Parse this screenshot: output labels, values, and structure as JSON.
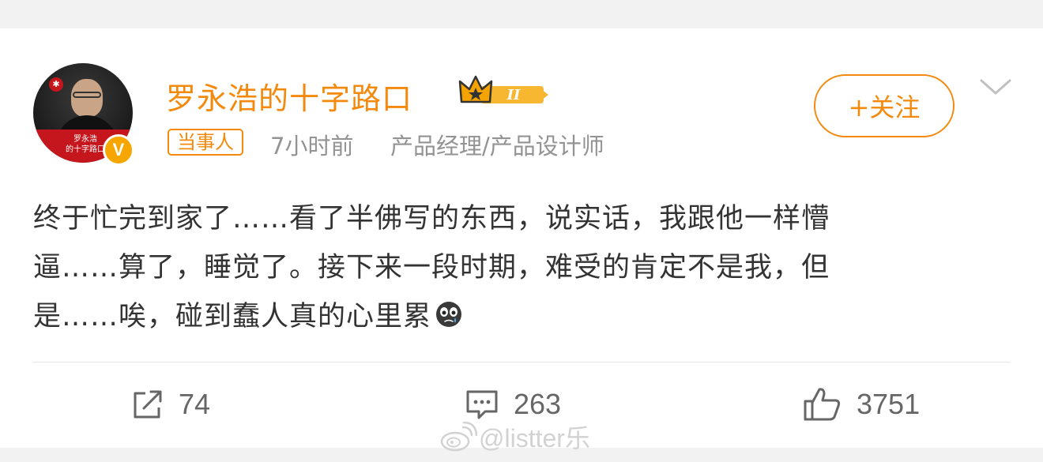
{
  "post": {
    "author": {
      "name": "罗永浩的十字路口",
      "avatar_caption_line1": "罗永浩",
      "avatar_caption_line2": "的十字路口",
      "verified_badge": "V",
      "vip_level": "II"
    },
    "tag": "当事人",
    "time": "7小时前",
    "source": "产品经理/产品设计师",
    "follow_label": "+关注",
    "content_lines": [
      "终于忙完到家了……看了半佛写的东西，说实话，我跟他一样懵",
      "逼……算了，睡觉了。接下来一段时期，难受的肯定不是我，但",
      "是……唉，碰到蠢人真的心里累"
    ],
    "actions": {
      "repost_count": "74",
      "comment_count": "263",
      "like_count": "3751"
    },
    "icons": {
      "repost": "share-icon",
      "comment": "comment-icon",
      "like": "thumbs-up-icon",
      "more": "chevron-down-icon",
      "emoji": "crying-emoji-icon",
      "vip": "crown-icon"
    }
  },
  "watermark": {
    "text": "@listter乐"
  },
  "colors": {
    "accent": "#f38a0e",
    "text": "#333333",
    "meta": "#939393",
    "background": "#f2f2f2"
  }
}
